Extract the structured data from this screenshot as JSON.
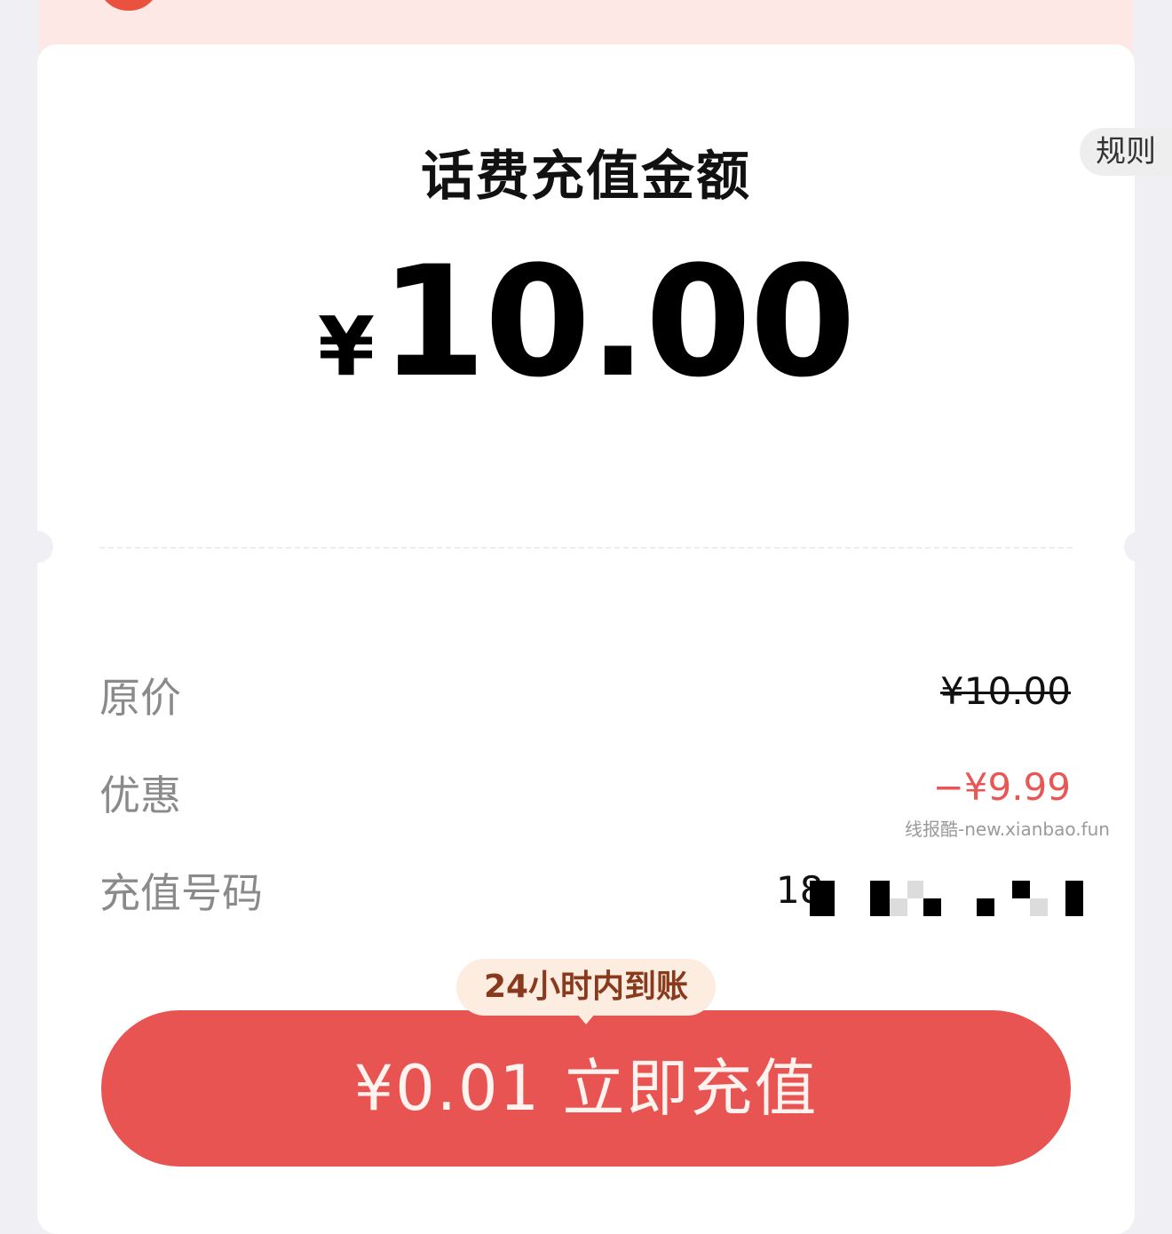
{
  "header": {
    "rules_label": "规则"
  },
  "amount": {
    "title": "话费充值金额",
    "currency": "¥",
    "value": "10.00"
  },
  "details": {
    "original_price_label": "原价",
    "original_price_value": "¥10.00",
    "discount_label": "优惠",
    "discount_value": "−¥9.99",
    "phone_label": "充值号码",
    "phone_value": "18"
  },
  "watermark": "线报酷-new.xianbao.fun",
  "cta": {
    "badge": "24小时内到账",
    "label": "¥0.01 立即充值"
  },
  "colors": {
    "accent": "#e85451",
    "discount": "#e85656",
    "badge_bg": "#fdece0",
    "badge_text": "#8a3a1c"
  }
}
